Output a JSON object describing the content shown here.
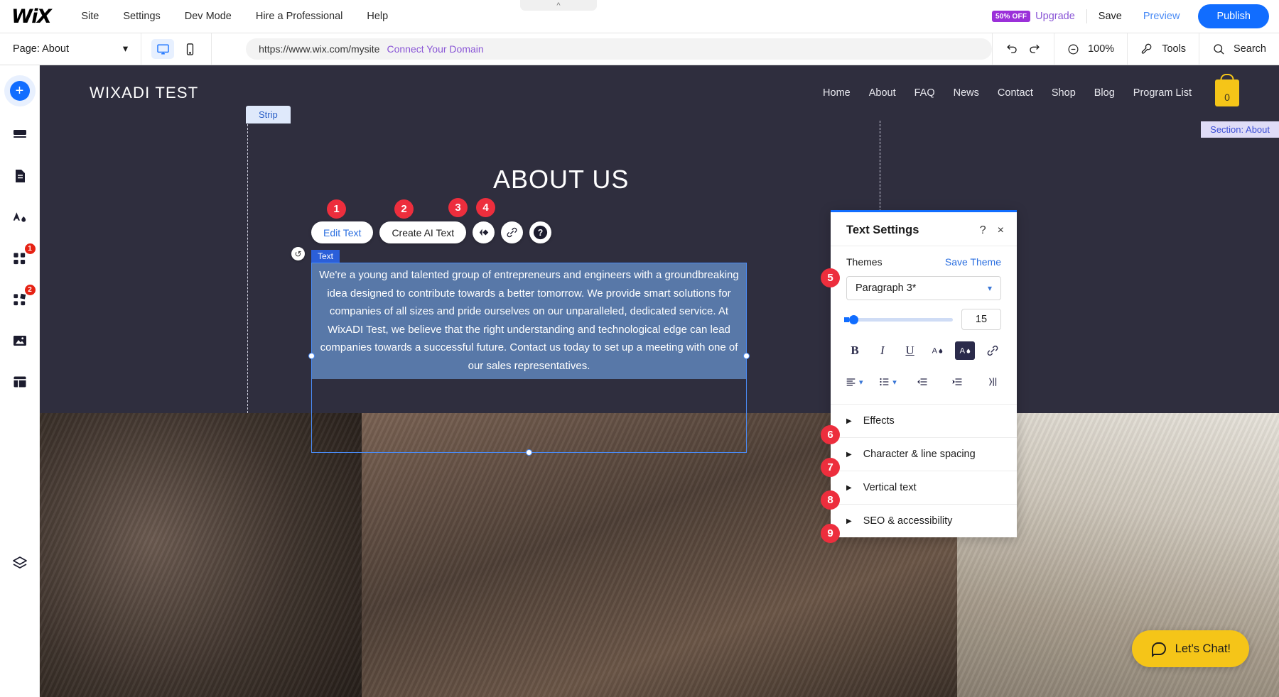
{
  "topbar": {
    "logo": "WiX",
    "menu": [
      "Site",
      "Settings",
      "Dev Mode",
      "Hire a Professional",
      "Help"
    ],
    "discount_badge": "50% OFF",
    "upgrade": "Upgrade",
    "save": "Save",
    "preview": "Preview",
    "publish": "Publish"
  },
  "toolbar": {
    "page_label": "Page: About",
    "url": "https://www.wix.com/mysite",
    "connect_domain": "Connect Your Domain",
    "zoom": "100%",
    "tools": "Tools",
    "search": "Search"
  },
  "sidebar": {
    "items": [
      {
        "name": "add",
        "badge": ""
      },
      {
        "name": "sections",
        "badge": ""
      },
      {
        "name": "pages",
        "badge": ""
      },
      {
        "name": "theme",
        "badge": ""
      },
      {
        "name": "apps",
        "badge": "1"
      },
      {
        "name": "integrations",
        "badge": "2"
      },
      {
        "name": "media",
        "badge": ""
      },
      {
        "name": "content-manager",
        "badge": ""
      },
      {
        "name": "layers",
        "badge": ""
      }
    ]
  },
  "site": {
    "logo": "WIXADI TEST",
    "nav": [
      "Home",
      "About",
      "FAQ",
      "News",
      "Contact",
      "Shop",
      "Blog",
      "Program List"
    ],
    "cart_count": "0",
    "strip_badge": "Strip",
    "section_badge": "Section: About",
    "hero_title": "ABOUT US",
    "text_label": "Text",
    "body_text": "We're a young and talented group of entrepreneurs and engineers with a groundbreaking idea designed to contribute towards a better tomorrow. We provide smart solutions for companies of all sizes and pride ourselves on our unparalleled, dedicated service. At WixADI Test, we believe that the right understanding and technological edge can lead companies towards a successful future. Contact us today to set up a meeting with one of our sales representatives."
  },
  "float_toolbar": {
    "edit_text": "Edit Text",
    "create_ai_text": "Create AI Text",
    "animation_icon": "animation-icon",
    "link_icon": "link-icon",
    "help_icon": "help-icon"
  },
  "panel": {
    "title": "Text Settings",
    "help": "?",
    "close": "×",
    "themes_label": "Themes",
    "save_theme": "Save Theme",
    "selected_theme": "Paragraph 3*",
    "font_size": "15",
    "format_icons": [
      "B",
      "I",
      "U",
      "text-color",
      "highlight-color",
      "link"
    ],
    "paragraph_icons": [
      "align",
      "bullet-list",
      "decrease-indent",
      "increase-indent",
      "text-direction"
    ],
    "sections": [
      {
        "label": "Effects"
      },
      {
        "label": "Character & line spacing"
      },
      {
        "label": "Vertical text"
      },
      {
        "label": "SEO & accessibility"
      }
    ]
  },
  "markers": {
    "m1": "1",
    "m2": "2",
    "m3": "3",
    "m4": "4",
    "m5": "5",
    "m6": "6",
    "m7": "7",
    "m8": "8",
    "m9": "9"
  },
  "chat": {
    "label": "Let's Chat!"
  }
}
